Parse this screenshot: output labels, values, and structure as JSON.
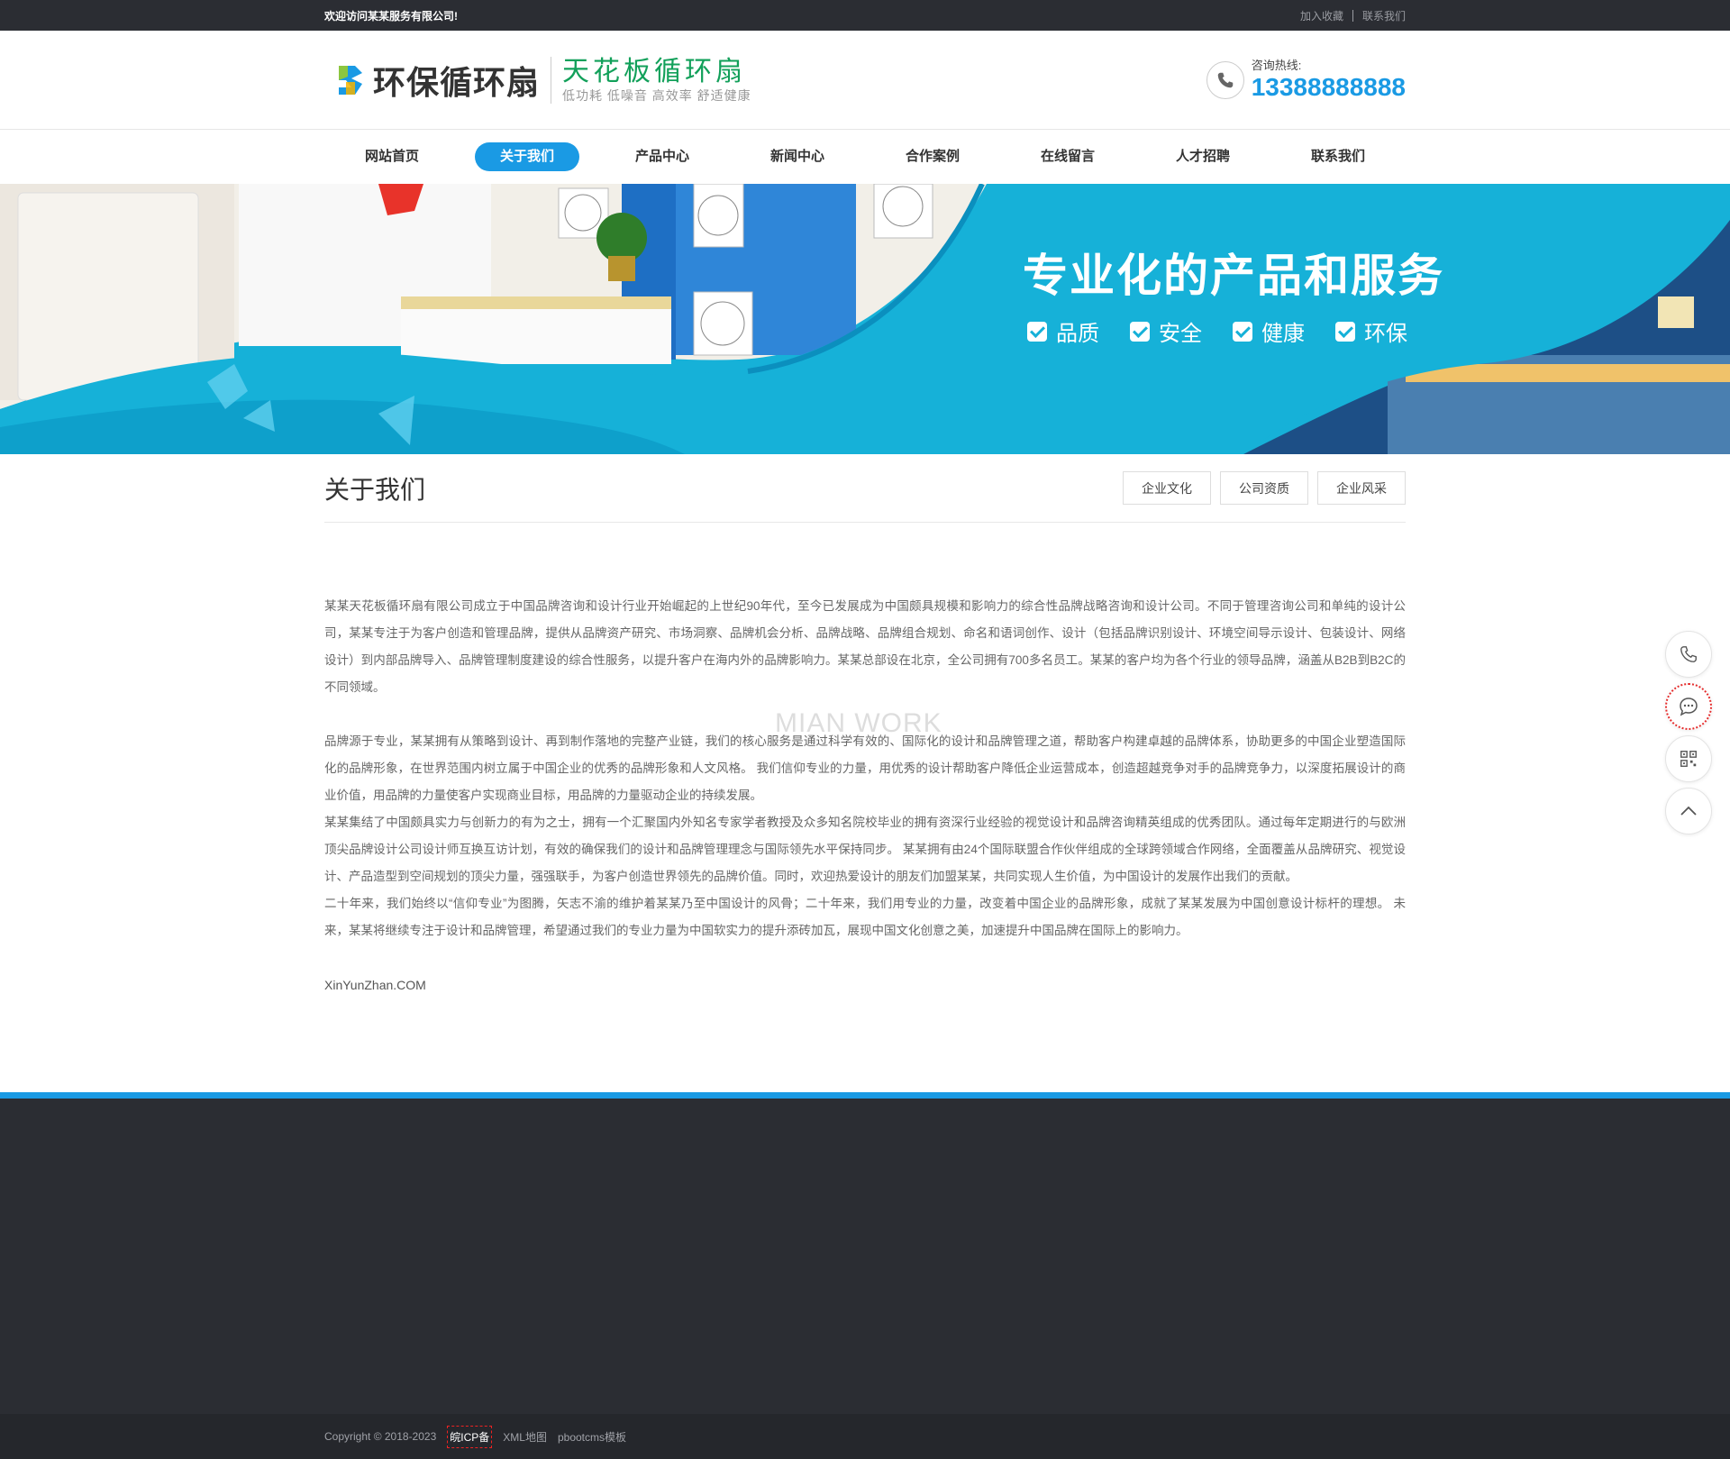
{
  "topbar": {
    "welcome": "欢迎访问某某服务有限公司!",
    "favorite": "加入收藏",
    "contact": "联系我们"
  },
  "header": {
    "logo_name": "环保循环扇",
    "logo_sub_title": "天花板循环扇",
    "logo_sub_tagline": "低功耗 低噪音 高效率 舒适健康",
    "hotline_label": "咨询热线:",
    "hotline_number": "13388888888",
    "icons": [
      "logo-icon",
      "phone-icon"
    ]
  },
  "nav": {
    "items": [
      {
        "label": "网站首页"
      },
      {
        "label": "关于我们"
      },
      {
        "label": "产品中心"
      },
      {
        "label": "新闻中心"
      },
      {
        "label": "合作案例"
      },
      {
        "label": "在线留言"
      },
      {
        "label": "人才招聘"
      },
      {
        "label": "联系我们"
      }
    ],
    "active_index": 1
  },
  "banner": {
    "slogan": "专业化的产品和服务",
    "features": [
      "品质",
      "安全",
      "健康",
      "环保"
    ]
  },
  "page": {
    "title": "关于我们",
    "subnav": [
      "企业文化",
      "公司资质",
      "企业风采"
    ]
  },
  "article": {
    "p1": "某某天花板循环扇有限公司成立于中国品牌咨询和设计行业开始崛起的上世纪90年代，至今已发展成为中国颇具规模和影响力的综合性品牌战略咨询和设计公司。不同于管理咨询公司和单纯的设计公司，某某专注于为客户创造和管理品牌，提供从品牌资产研究、市场洞察、品牌机会分析、品牌战略、品牌组合规划、命名和语词创作、设计（包括品牌识别设计、环境空间导示设计、包装设计、网络设计）到内部品牌导入、品牌管理制度建设的综合性服务，以提升客户在海内外的品牌影响力。某某总部设在北京，全公司拥有700多名员工。某某的客户均为各个行业的领导品牌，涵盖从B2B到B2C的不同领域。",
    "p2": "品牌源于专业，某某拥有从策略到设计、再到制作落地的完整产业链，我们的核心服务是通过科学有效的、国际化的设计和品牌管理之道，帮助客户构建卓越的品牌体系，协助更多的中国企业塑造国际化的品牌形象，在世界范围内树立属于中国企业的优秀的品牌形象和人文风格。 我们信仰专业的力量，用优秀的设计帮助客户降低企业运营成本，创造超越竞争对手的品牌竞争力，以深度拓展设计的商业价值，用品牌的力量使客户实现商业目标，用品牌的力量驱动企业的持续发展。",
    "p3": "某某集结了中国颇具实力与创新力的有为之士，拥有一个汇聚国内外知名专家学者教授及众多知名院校毕业的拥有资深行业经验的视觉设计和品牌咨询精英组成的优秀团队。通过每年定期进行的与欧洲顶尖品牌设计公司设计师互换互访计划，有效的确保我们的设计和品牌管理理念与国际领先水平保持同步。 某某拥有由24个国际联盟合作伙伴组成的全球跨领域合作网络，全面覆盖从品牌研究、视觉设计、产品造型到空间规划的顶尖力量，强强联手，为客户创造世界领先的品牌价值。同时，欢迎热爱设计的朋友们加盟某某，共同实现人生价值，为中国设计的发展作出我们的贡献。",
    "p4": "二十年来，我们始终以“信仰专业”为图腾，矢志不渝的维护着某某乃至中国设计的风骨；二十年来，我们用专业的力量，改变着中国企业的品牌形象，成就了某某发展为中国创意设计标杆的理想。 未来，某某将继续专注于设计和品牌管理，希望通过我们的专业力量为中国软实力的提升添砖加瓦，展现中国文化创意之美，加速提升中国品牌在国际上的影响力。",
    "site": "XinYunZhan.COM",
    "watermark": "MIAN WORK"
  },
  "footer": {
    "copyright": "Copyright © 2018-2023",
    "icp": "皖ICP备",
    "sitemap": "XML地图",
    "template": "pbootcms模板"
  },
  "side_tools": [
    "phone-icon",
    "chat-icon",
    "qrcode-icon",
    "chevron-up-icon"
  ],
  "colors": {
    "accent": "#1a9ae4",
    "banner": "#16b1d8",
    "dark": "#2b2d33",
    "logo_green": "#12a05a"
  }
}
